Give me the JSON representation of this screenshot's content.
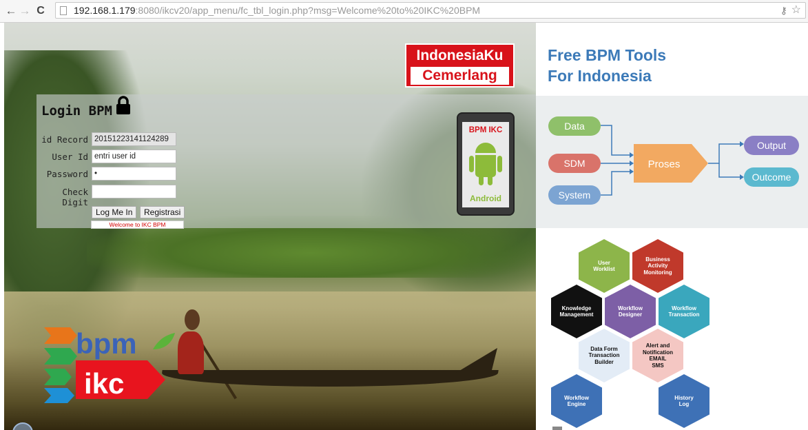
{
  "browser": {
    "url_host": "192.168.1.179",
    "url_rest": ":8080/ikcv20/app_menu/fc_tbl_login.php?msg=Welcome%20to%20IKC%20BPM"
  },
  "badge": {
    "line1": "IndonesiaKu",
    "line2": "Cemerlang"
  },
  "login": {
    "title": "Login BPM",
    "fields": [
      {
        "label": "id Record",
        "value": "20151223141124289"
      },
      {
        "label": "User Id",
        "value": "entri user id"
      },
      {
        "label": "Password",
        "value": "•"
      },
      {
        "label": "Check Digit",
        "value": ""
      }
    ],
    "buttons": {
      "login": "Log Me In",
      "register": "Registrasi"
    },
    "message": "Welcome to IKC BPM"
  },
  "phone": {
    "title": "BPM IKC",
    "caption": "Android"
  },
  "logo": {
    "top": "bpm",
    "bottom": "ikc"
  },
  "right": {
    "title_line1": "Free BPM Tools",
    "title_line2": "For Indonesia",
    "flow": {
      "inputs": [
        "Data",
        "SDM",
        "System"
      ],
      "process": "Proses",
      "outputs": [
        "Output",
        "Outcome"
      ]
    },
    "hexagons": [
      {
        "label": "User\nWorklist",
        "color": "#8db54a"
      },
      {
        "label": "Business\nActivity\nMonitoring",
        "color": "#c0392b"
      },
      {
        "label": "Knowledge\nManagement",
        "color": "#111111"
      },
      {
        "label": "Workflow\nDesigner",
        "color": "#7d5fa6"
      },
      {
        "label": "Workflow\nTransaction",
        "color": "#3aa7bd"
      },
      {
        "label": "Data Form\nTransaction\nBuilder",
        "color": "#e3ecf6"
      },
      {
        "label": "Alert and\nNotification\nEMAIL\nSMS",
        "color": "#f4c7c3"
      },
      {
        "label": "Workflow\nEngine",
        "color": "#3e71b6"
      },
      {
        "label": "History\nLog",
        "color": "#3e71b6"
      }
    ]
  },
  "colors": {
    "accent_blue": "#3c7ab8",
    "brand_red": "#d8121a",
    "android_green": "#8dbb3a"
  }
}
